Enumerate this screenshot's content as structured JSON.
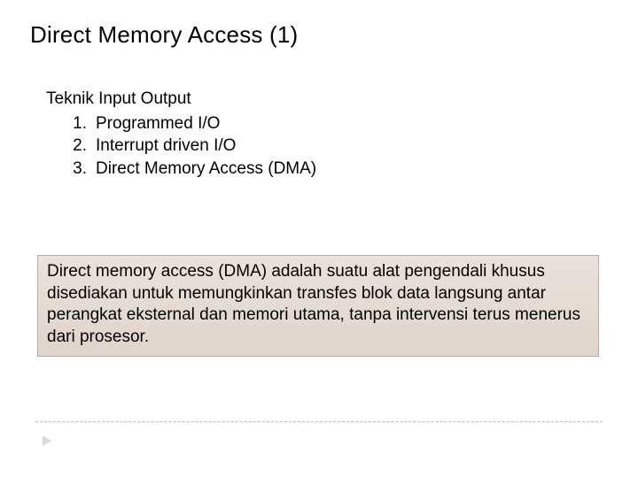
{
  "title": "Direct Memory Access (1)",
  "subhead": "Teknik Input Output",
  "list": {
    "0": {
      "num": "1.",
      "text": "Programmed I/O"
    },
    "1": {
      "num": "2.",
      "text": "Interrupt driven I/O"
    },
    "2": {
      "num": "3.",
      "text": "Direct Memory Access (DMA)"
    }
  },
  "definition": "Direct memory access (DMA) adalah suatu alat pengendali khusus disediakan untuk memungkinkan transfes blok data langsung antar perangkat eksternal dan memori utama, tanpa intervensi terus menerus dari prosesor."
}
